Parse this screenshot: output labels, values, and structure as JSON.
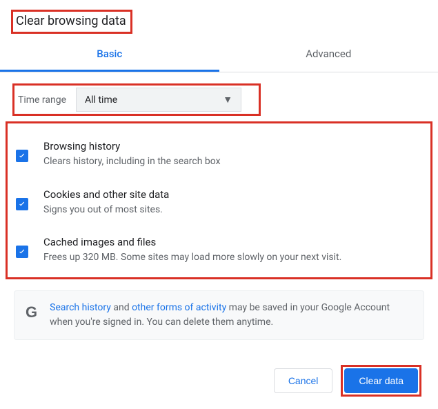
{
  "title": "Clear browsing data",
  "tabs": {
    "basic": "Basic",
    "advanced": "Advanced"
  },
  "time": {
    "label": "Time range",
    "value": "All time"
  },
  "options": [
    {
      "title": "Browsing history",
      "desc": "Clears history, including in the search box"
    },
    {
      "title": "Cookies and other site data",
      "desc": "Signs you out of most sites."
    },
    {
      "title": "Cached images and files",
      "desc": "Frees up 320 MB. Some sites may load more slowly on your next visit."
    }
  ],
  "info": {
    "link1": "Search history",
    "mid1": " and ",
    "link2": "other forms of activity",
    "rest": " may be saved in your Google Account when you're signed in. You can delete them anytime."
  },
  "buttons": {
    "cancel": "Cancel",
    "clear": "Clear data"
  }
}
